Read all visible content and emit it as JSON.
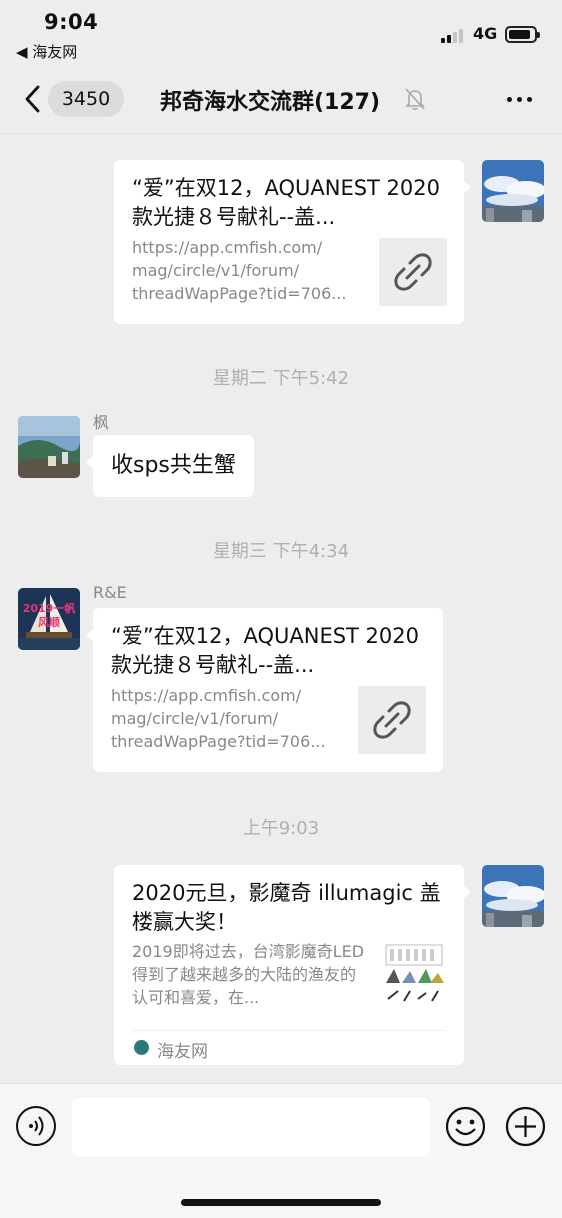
{
  "status_bar": {
    "time": "9:04",
    "back_app": "◀ 海友网",
    "network": "4G"
  },
  "nav": {
    "unread_count": "3450",
    "title": "邦奇海水交流群(127)"
  },
  "messages": {
    "m1": {
      "title": "“爱”在双12，AQUANEST 2020款光捷８号献礼--盖...",
      "url": "https://app.cmfish.com/\nmag/circle/v1/forum/\nthreadWapPage?tid=706..."
    },
    "ts1": "星期二 下午5:42",
    "m2": {
      "sender": "枫",
      "text": "收sps共生蟹"
    },
    "ts2": "星期三 下午4:34",
    "m3": {
      "sender": "R&E",
      "avatar_text": "2019一帆风顺",
      "title": "“爱”在双12，AQUANEST 2020款光捷８号献礼--盖...",
      "url": "https://app.cmfish.com/\nmag/circle/v1/forum/\nthreadWapPage?tid=706..."
    },
    "ts3": "上午9:03",
    "m4": {
      "title": "2020元旦，影魔奇 illumagic 盖楼赢大奖！",
      "desc": "2019即将过去，台湾影魔奇LED得到了越来越多的大陆的渔友的认可和喜爱，在...",
      "source": "海友网"
    }
  },
  "input_bar": {
    "placeholder": ""
  },
  "colors": {
    "background": "#ededed",
    "bubble": "#ffffff",
    "meta_text": "#888888"
  }
}
